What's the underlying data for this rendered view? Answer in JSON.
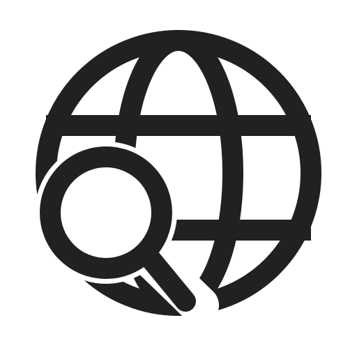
{
  "icon": {
    "name": "globe-search-icon",
    "color": "#212121",
    "background": "#ffffff"
  }
}
